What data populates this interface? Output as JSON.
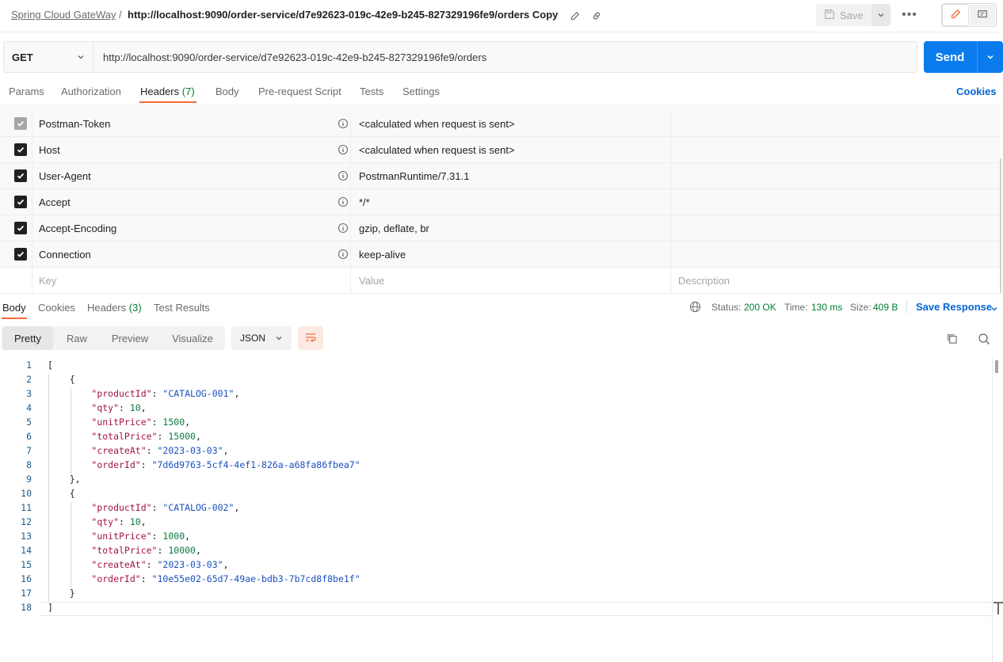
{
  "breadcrumb": {
    "parent": "Spring Cloud GateWay",
    "separator": "/",
    "title": "http://localhost:9090/order-service/d7e92623-019c-42e9-b245-827329196fe9/orders Copy"
  },
  "toolbar": {
    "save_label": "Save",
    "more_label": "•••"
  },
  "request": {
    "method": "GET",
    "url": "http://localhost:9090/order-service/d7e92623-019c-42e9-b245-827329196fe9/orders",
    "send_label": "Send"
  },
  "request_tabs": [
    {
      "label": "Params"
    },
    {
      "label": "Authorization"
    },
    {
      "label": "Headers",
      "count": "(7)"
    },
    {
      "label": "Body"
    },
    {
      "label": "Pre-request Script"
    },
    {
      "label": "Tests"
    },
    {
      "label": "Settings"
    }
  ],
  "cookies_label": "Cookies",
  "headers": [
    {
      "key": "Postman-Token",
      "value": "<calculated when request is sent>",
      "checked": true,
      "disabled": true
    },
    {
      "key": "Host",
      "value": "<calculated when request is sent>",
      "checked": true,
      "disabled": false
    },
    {
      "key": "User-Agent",
      "value": "PostmanRuntime/7.31.1",
      "checked": true,
      "disabled": false
    },
    {
      "key": "Accept",
      "value": "*/*",
      "checked": true,
      "disabled": false
    },
    {
      "key": "Accept-Encoding",
      "value": "gzip, deflate, br",
      "checked": true,
      "disabled": false
    },
    {
      "key": "Connection",
      "value": "keep-alive",
      "checked": true,
      "disabled": false
    }
  ],
  "new_header": {
    "key_placeholder": "Key",
    "value_placeholder": "Value",
    "description_placeholder": "Description"
  },
  "response_tabs": [
    {
      "label": "Body"
    },
    {
      "label": "Cookies"
    },
    {
      "label": "Headers",
      "count": "(3)"
    },
    {
      "label": "Test Results"
    }
  ],
  "response_status": {
    "status_label": "Status:",
    "status_value": "200 OK",
    "time_label": "Time:",
    "time_value": "130 ms",
    "size_label": "Size:",
    "size_value": "409 B",
    "save_response_label": "Save Response"
  },
  "view_modes": [
    "Pretty",
    "Raw",
    "Preview",
    "Visualize"
  ],
  "format": "JSON",
  "response_body": [
    {
      "productId": "CATALOG-001",
      "qty": 10,
      "unitPrice": 1500,
      "totalPrice": 15000,
      "createAt": "2023-03-03",
      "orderId": "7d6d9763-5cf4-4ef1-826a-a68fa86fbea7"
    },
    {
      "productId": "CATALOG-002",
      "qty": 10,
      "unitPrice": 1000,
      "totalPrice": 10000,
      "createAt": "2023-03-03",
      "orderId": "10e55e02-65d7-49ae-bdb3-7b7cd8f8be1f"
    }
  ],
  "colors": {
    "accent": "#f26b3a",
    "send": "#097bed",
    "link": "#0265d2",
    "status_ok": "#007f31"
  }
}
